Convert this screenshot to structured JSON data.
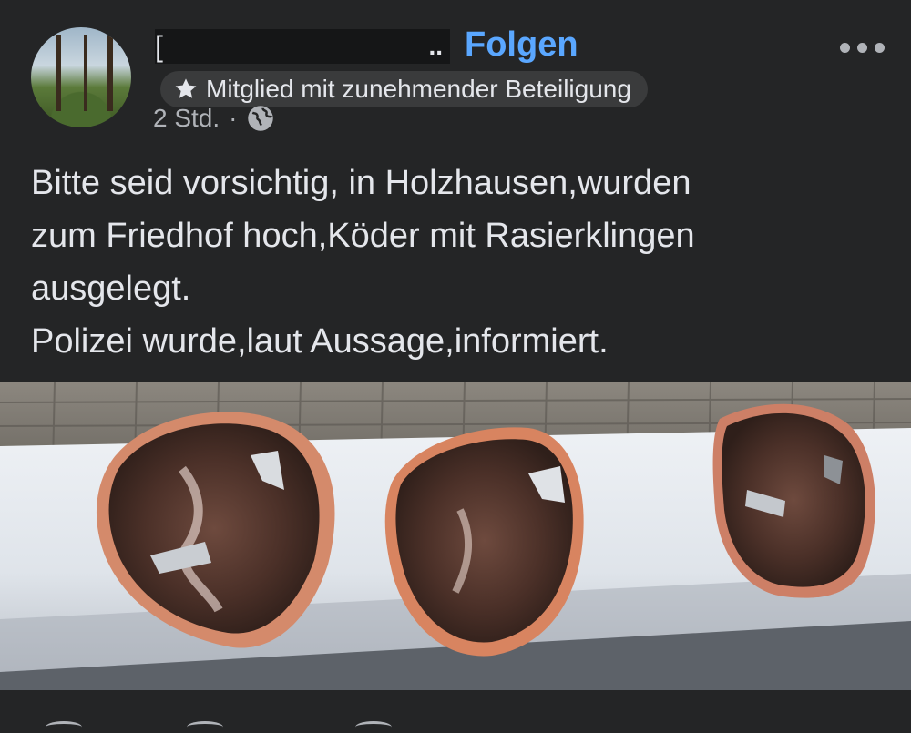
{
  "post": {
    "author_redacted_visible": "[",
    "author_ellipsis": "..",
    "follow_label": "Folgen",
    "badge_label": "Mitglied mit zunehmender Beteiligung",
    "time_ago": "2 Std.",
    "separator": "·",
    "audience_icon": "globe-icon",
    "text": "Bitte seid vorsichtig, in Holzhausen,wurden\nzum Friedhof hoch,Köder mit Rasierklingen\nausgelegt.\nPolizei wurde,laut Aussage,informiert."
  },
  "icons": {
    "more": "more-options-icon",
    "badge": "star-icon"
  },
  "colors": {
    "background": "#242526",
    "text": "#e4e6eb",
    "link": "#5aa7ff",
    "secondary": "#b0b3b8",
    "badge_bg": "#3a3b3c"
  }
}
